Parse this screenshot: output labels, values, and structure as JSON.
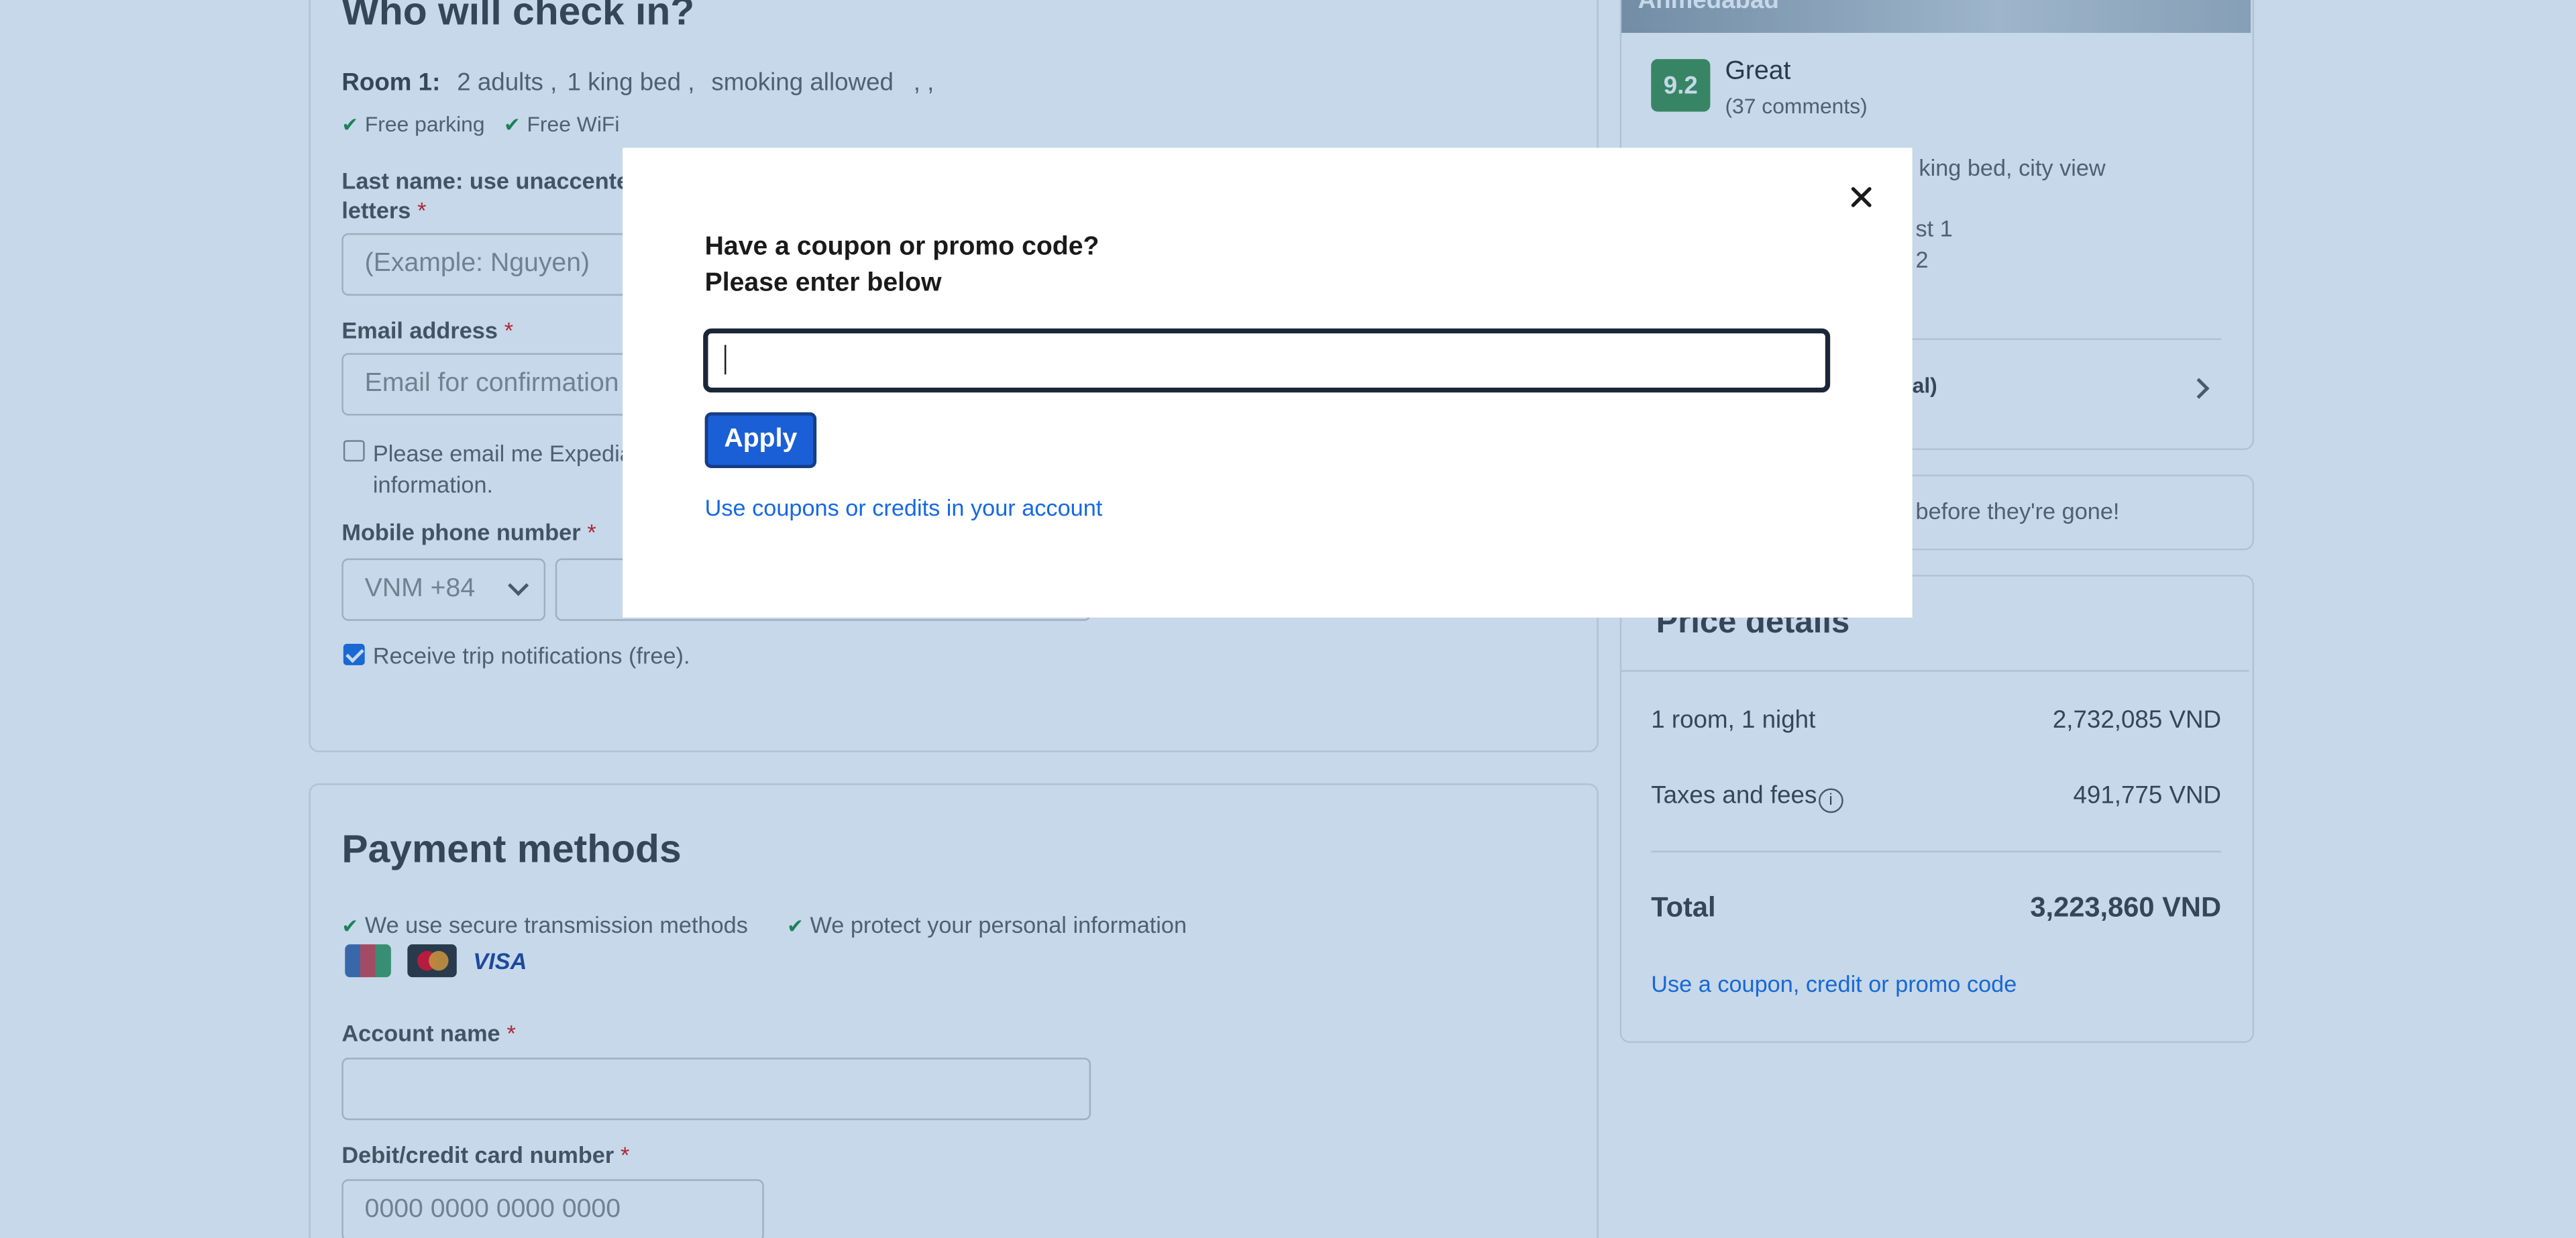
{
  "checkin": {
    "heading": "Who will check in?",
    "room_label": "Room 1:",
    "room_details": [
      "2 adults",
      ",",
      "1 king bed",
      ",",
      "smoking allowed",
      ", ,"
    ],
    "amenities": [
      "Free parking",
      "Free WiFi"
    ],
    "last_name_label_line1": "Last name: use unaccented",
    "last_name_label_line2": "letters",
    "last_name_placeholder": "(Example: Nguyen)",
    "email_label": "Email address",
    "email_placeholder": "Email for confirmation",
    "email_opt_line1": "Please email me Expedia",
    "email_opt_line2": "information.",
    "phone_label": "Mobile phone number",
    "phone_country": "VNM +84",
    "notify_label": "Receive trip notifications (free).",
    "required_mark": "*"
  },
  "payment": {
    "heading": "Payment methods",
    "secure_1": "We use secure transmission methods",
    "secure_2": "We protect your personal information",
    "card_brands": [
      "JCB",
      "Mastercard",
      "VISA"
    ],
    "visa_text": "VISA",
    "account_name_label": "Account name",
    "card_number_label": "Debit/credit card number",
    "card_number_placeholder": "0000 0000 0000 0000"
  },
  "hotel": {
    "city_fragment": "Ahmedabad",
    "rating": "9.2",
    "rating_word": "Great",
    "comments": "(37 comments)",
    "room_fragment": "king bed, city view",
    "line_a": "st 1",
    "line_b": "2",
    "total_fragment": "al)",
    "urgency_fragment": "before they're gone!"
  },
  "price": {
    "heading": "Price details",
    "rows": [
      {
        "label": "1 room, 1 night",
        "value": "2,732,085 VND"
      },
      {
        "label": "Taxes and fees",
        "value": "491,775 VND"
      }
    ],
    "total_label": "Total",
    "total_value": "3,223,860 VND",
    "coupon_link": "Use a coupon, credit or promo code"
  },
  "modal": {
    "title_line1": "Have a coupon or promo code?",
    "title_line2": "Please enter below",
    "input_value": "",
    "apply_label": "Apply",
    "account_link": "Use coupons or credits in your account"
  },
  "colors": {
    "overlay": "#2268aa",
    "primary": "#1b5fd6",
    "link": "#1668e3",
    "rating_badge": "#3e8f4d"
  }
}
